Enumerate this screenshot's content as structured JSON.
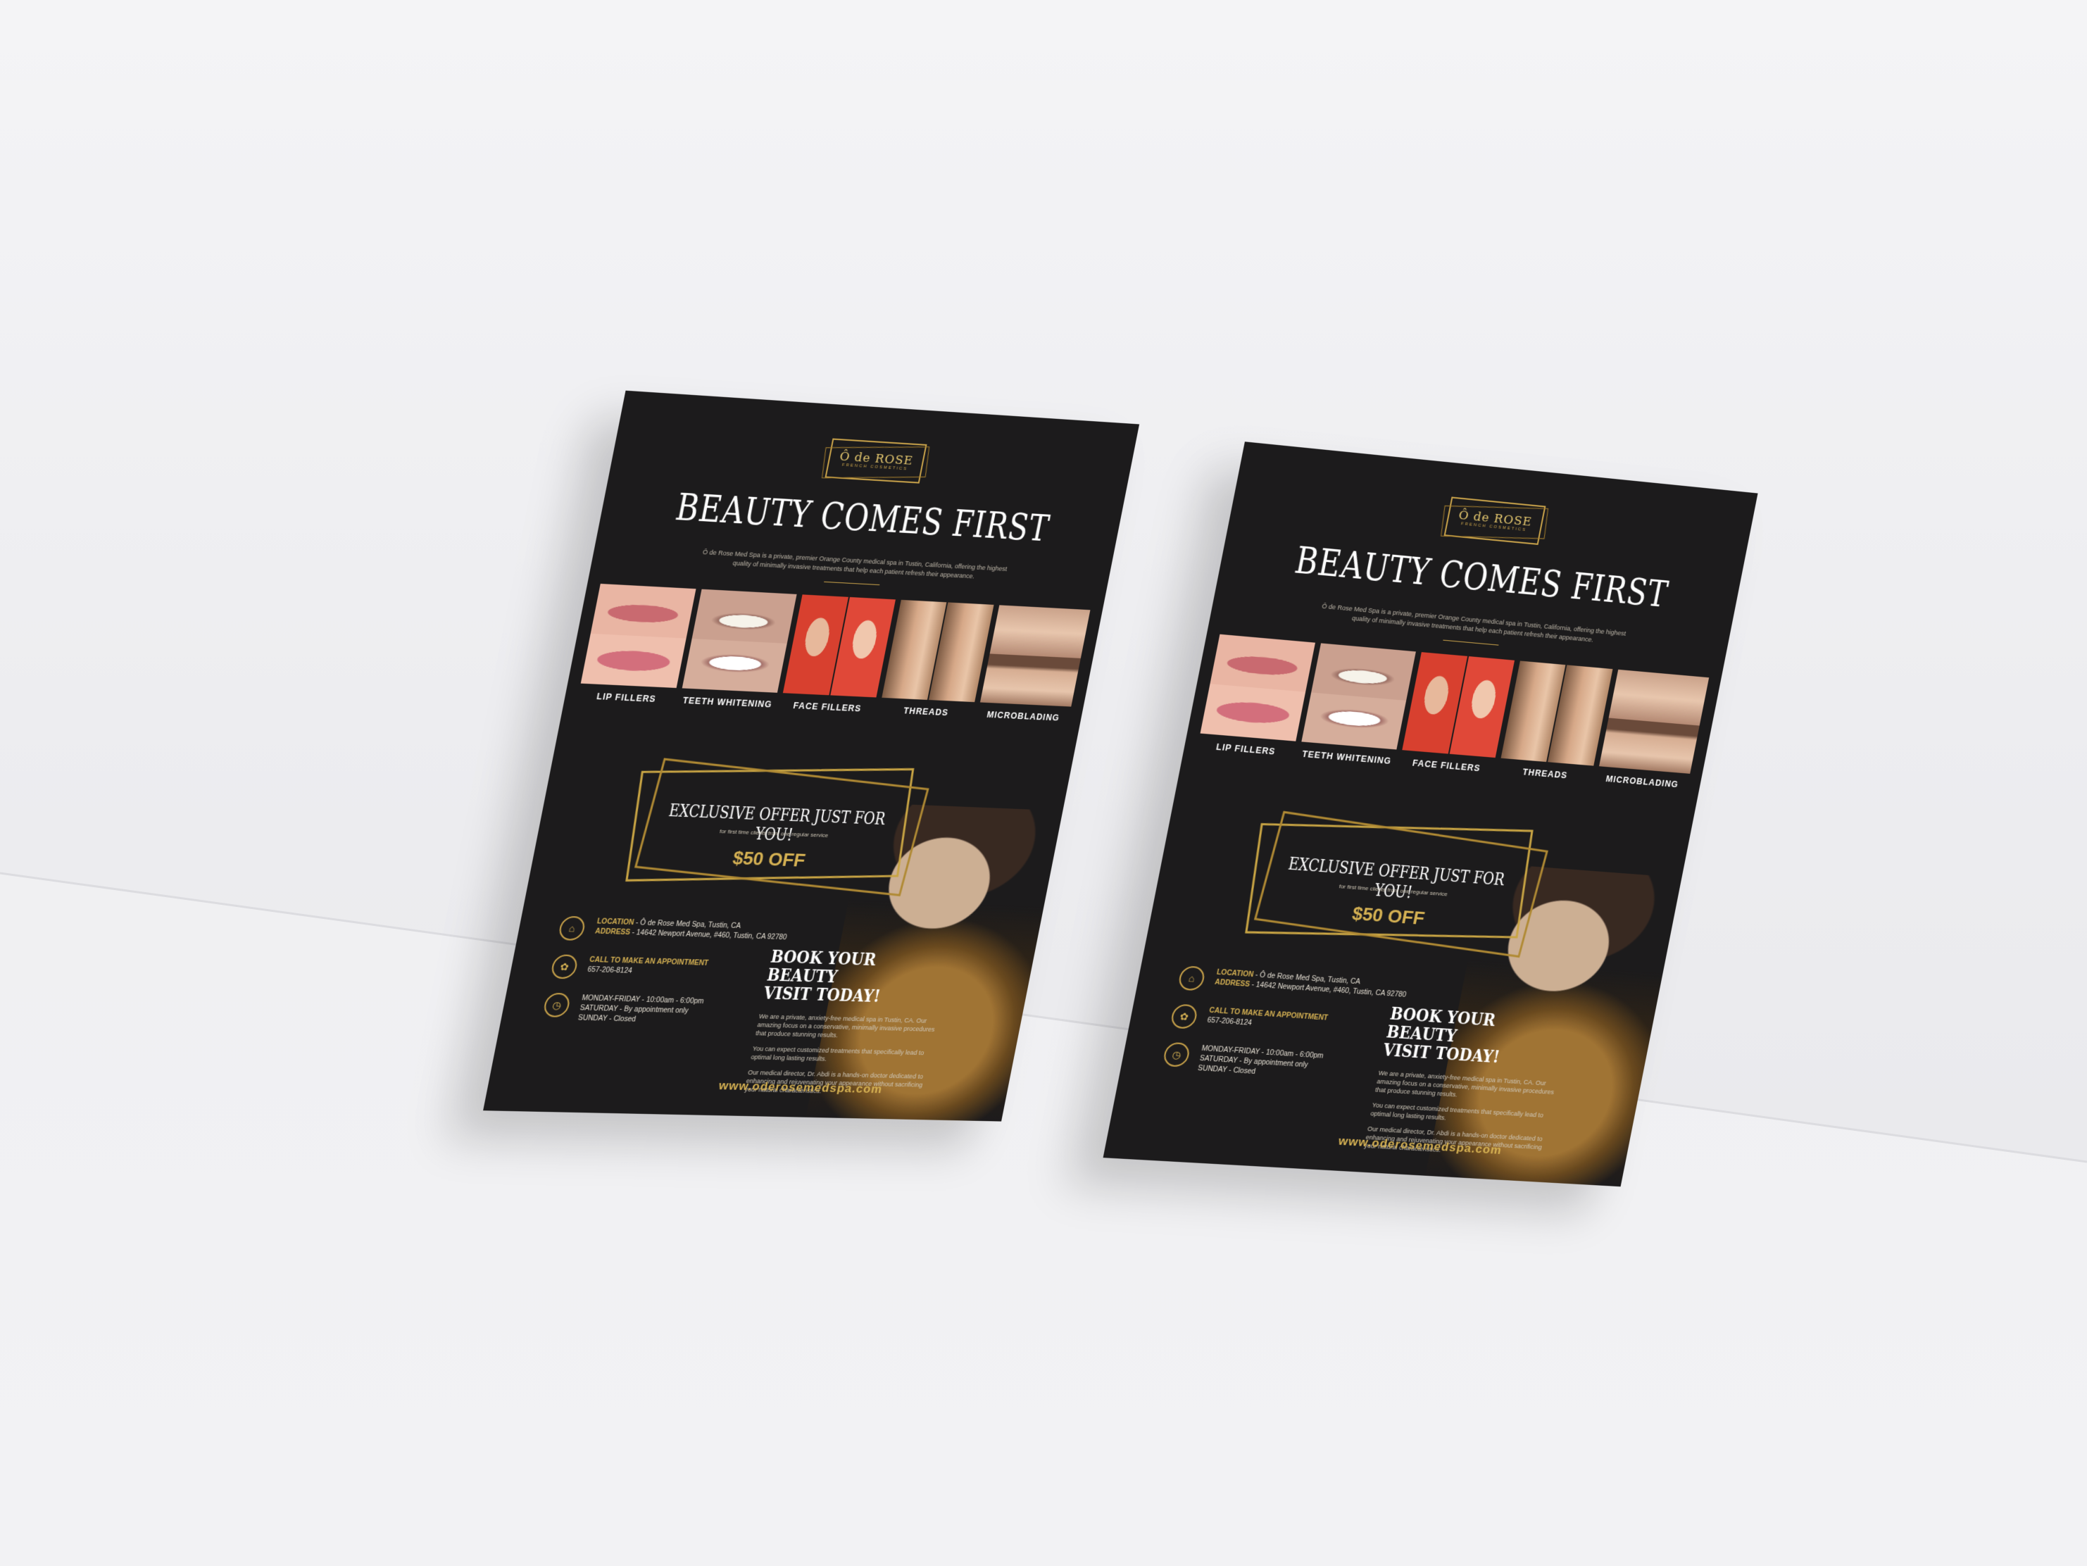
{
  "scene": {
    "description_label": "Two printed flyers leaning against a wall"
  },
  "flyer": {
    "logo": {
      "name": "Ô de ROSE",
      "tagline": "FRENCH COSMETICS"
    },
    "title": "BEAUTY COMES FIRST",
    "intro": "Ô de Rose Med Spa is a private, premier Orange County medical spa in Tustin, California, offering the highest quality of minimally invasive treatments that help each patient refresh their appearance.",
    "services": [
      {
        "label": "LIP FILLERS",
        "photo": "lip-fillers-photo"
      },
      {
        "label": "TEETH WHITENING",
        "photo": "teeth-whitening-photo"
      },
      {
        "label": "FACE FILLERS",
        "photo": "face-fillers-photo"
      },
      {
        "label": "THREADS",
        "photo": "threads-photo"
      },
      {
        "label": "MICROBLADING",
        "photo": "microblading-photo"
      }
    ],
    "offer": {
      "title": "EXCLUSIVE OFFER JUST FOR YOU!",
      "subtitle": "for first time clients from one regular service",
      "price": "$50 OFF"
    },
    "contact": {
      "location_label": "LOCATION",
      "location_value": " - Ô de Rose Med Spa, Tustin, CA",
      "address_label": "ADDRESS",
      "address_value": " - 14642 Newport Avenue, #460, Tustin, CA 92780",
      "call_label": "CALL TO MAKE AN APPOINTMENT",
      "phone": "657-206-8124",
      "hours_weekday": "MONDAY-FRIDAY - 10:00am - 6:00pm",
      "hours_saturday": "SATURDAY - By appointment only",
      "hours_sunday": "SUNDAY - Closed"
    },
    "book": {
      "title_line1": "BOOK YOUR BEAUTY",
      "title_line2": "VISIT TODAY!",
      "para1": "We are a private, anxiety-free medical spa in Tustin, CA. Our amazing focus on a conservative, minimally invasive procedures that produce stunning results.",
      "para2": "You can expect customized treatments that specifically lead to optimal long lasting results.",
      "para3": "Our medical director, Dr. Abdi is a hands-on doctor dedicated to enhancing and rejuvenating your appearance without sacrificing your natural characteristics."
    },
    "website": "www.oderosemedspa.com"
  },
  "colors": {
    "flyer_bg": "#1c1b1c",
    "gold": "#d5b153",
    "wall": "#ececef"
  }
}
